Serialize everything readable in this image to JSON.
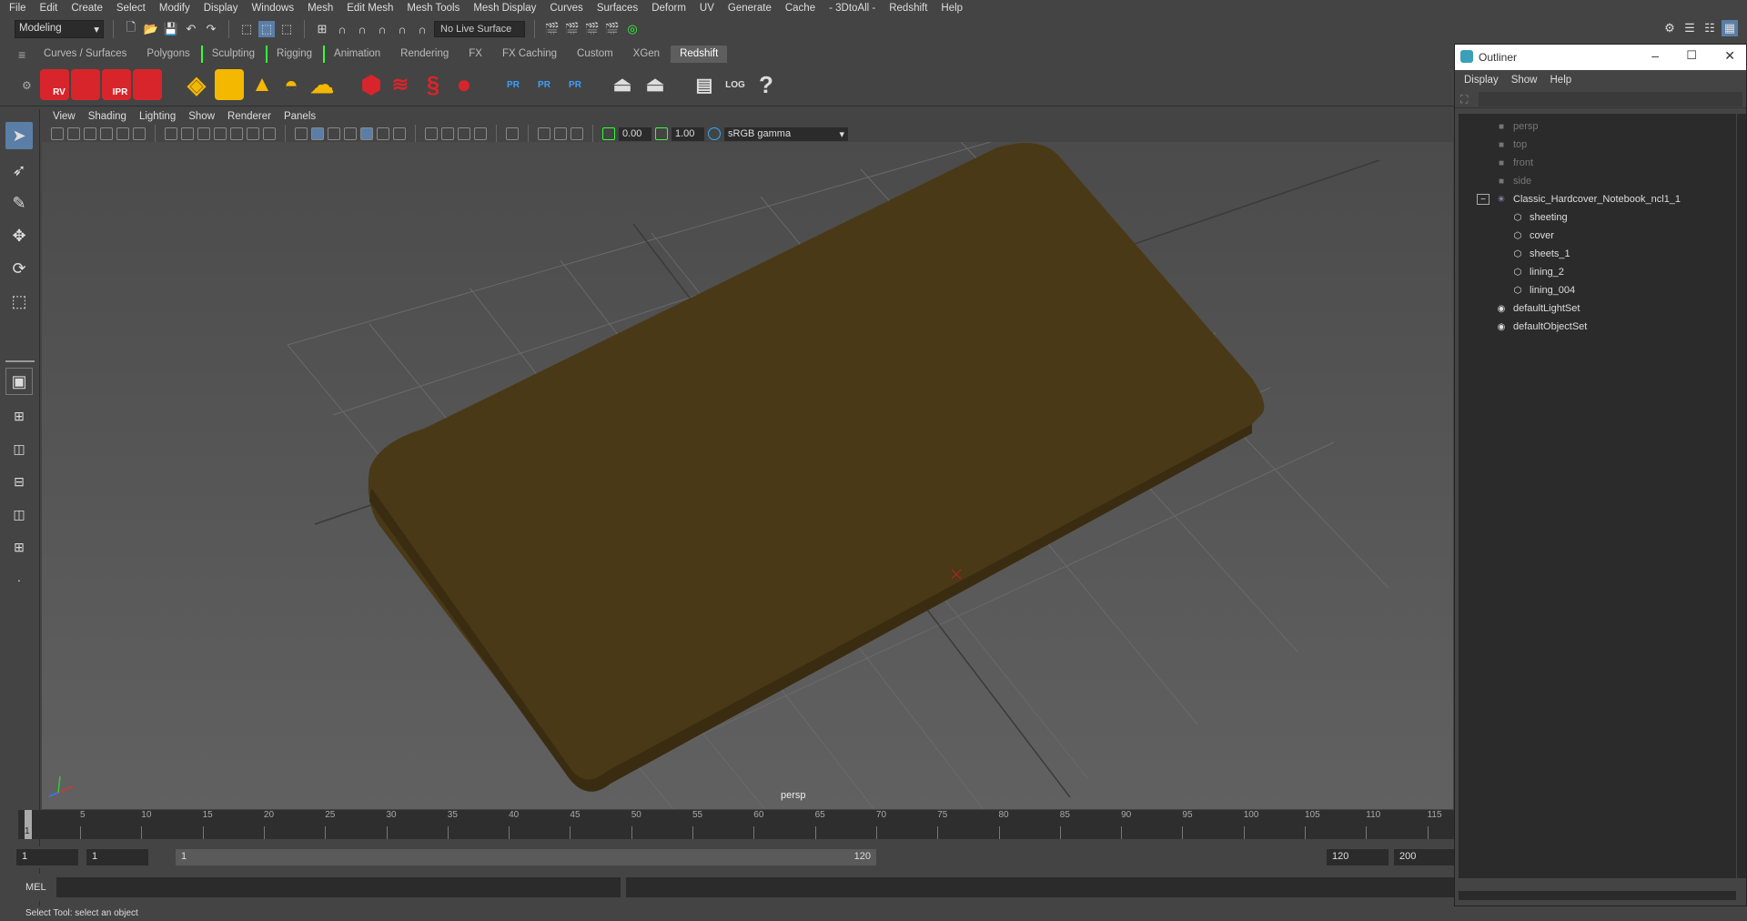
{
  "menubar": {
    "items": [
      "File",
      "Edit",
      "Create",
      "Select",
      "Modify",
      "Display",
      "Windows",
      "Mesh",
      "Edit Mesh",
      "Mesh Tools",
      "Mesh Display",
      "Curves",
      "Surfaces",
      "Deform",
      "UV",
      "Generate",
      "Cache",
      "- 3DtoAll -",
      "Redshift",
      "Help"
    ]
  },
  "statusline": {
    "mode": "Modeling",
    "live_surface": "No Live Surface"
  },
  "shelf": {
    "tabs": [
      "Curves / Surfaces",
      "Polygons",
      "Sculpting",
      "Rigging",
      "Animation",
      "Rendering",
      "FX",
      "FX Caching",
      "Custom",
      "XGen",
      "Redshift"
    ],
    "active_tab": "Redshift",
    "icon_labels": {
      "rv": "RV",
      "ipr": "IPR",
      "pr1": "PR",
      "pr2": "PR",
      "pr3": "PR",
      "log": "LOG",
      "help": "?"
    }
  },
  "panel": {
    "menu": [
      "View",
      "Shading",
      "Lighting",
      "Show",
      "Renderer",
      "Panels"
    ],
    "exposure": "0.00",
    "gamma_value": "1.00",
    "color_space": "sRGB gamma",
    "camera_label": "persp"
  },
  "timeline": {
    "ticks": [
      "5",
      "10",
      "15",
      "20",
      "25",
      "30",
      "35",
      "40",
      "45",
      "50",
      "55",
      "60",
      "65",
      "70",
      "75",
      "80",
      "85",
      "90",
      "95",
      "100",
      "105",
      "110",
      "115"
    ],
    "current_frame": "1"
  },
  "range": {
    "start": "1",
    "anim_start": "1",
    "slider_start": "1",
    "slider_end": "120",
    "end": "120",
    "anim_end": "200"
  },
  "cmd": {
    "label": "MEL"
  },
  "help": {
    "text": "Select Tool: select an object"
  },
  "outliner": {
    "title": "Outliner",
    "menu": [
      "Display",
      "Show",
      "Help"
    ],
    "cameras": [
      "persp",
      "top",
      "front",
      "side"
    ],
    "group": "Classic_Hardcover_Notebook_ncl1_1",
    "children": [
      "sheeting",
      "cover",
      "sheets_1",
      "lining_2",
      "lining_004"
    ],
    "sets": [
      "defaultLightSet",
      "defaultObjectSet"
    ]
  },
  "colors": {
    "accent": "#5a7ea6",
    "model": "#4a3916",
    "redshift_red": "#d8252b"
  }
}
